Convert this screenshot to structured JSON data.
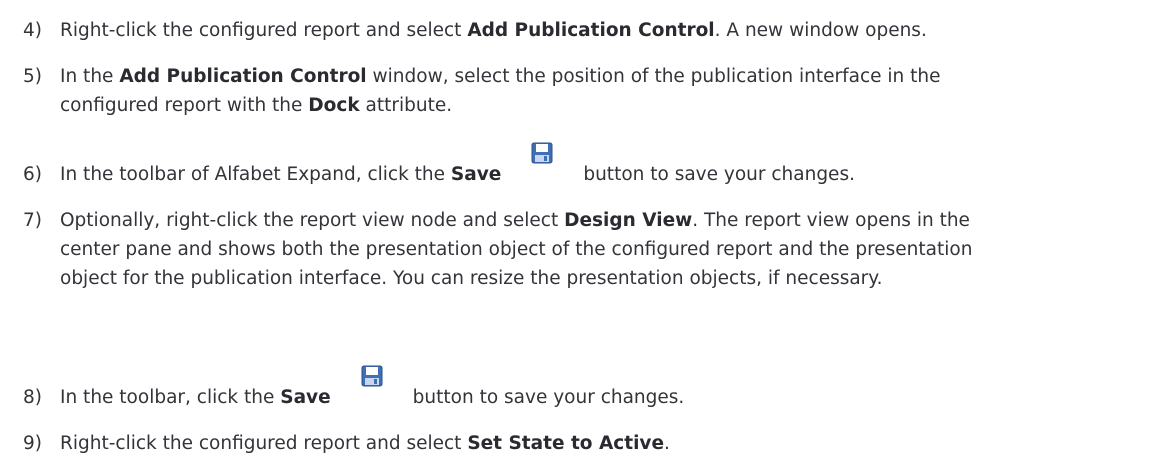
{
  "steps": [
    {
      "number": "4)",
      "segments": [
        {
          "t": "Right-click the configured report and select "
        },
        {
          "b": "Add Publication Control"
        },
        {
          "t": ". A new window opens."
        }
      ]
    },
    {
      "number": "5)",
      "line1": [
        {
          "t": "In the "
        },
        {
          "b": "Add Publication Control"
        },
        {
          "t": " window, select the position of the publication interface in the"
        }
      ],
      "line2": [
        {
          "t": "configured report with the "
        },
        {
          "b": "Dock"
        },
        {
          "t": " attribute."
        }
      ]
    },
    {
      "number": "6)",
      "before": "In the toolbar of Alfabet Expand, click the ",
      "bold": "Save",
      "after": "button to save your changes."
    },
    {
      "number": "7)",
      "line1_before": "Optionally, right-click the report view node and select ",
      "line1_bold": "Design View",
      "line1_after": ". The report view opens in the",
      "line2": "center pane and shows both the presentation object of the configured report and the presentation",
      "line3": "object for the publication interface. You can resize the presentation objects, if necessary."
    },
    {
      "number": "8)",
      "before": "In the toolbar, click the ",
      "bold": "Save",
      "after": "button to save your changes."
    },
    {
      "number": "9)",
      "before": "Right-click the configured report and select ",
      "bold": "Set State to Active",
      "after": "."
    }
  ],
  "icons": {
    "save": "save-icon"
  },
  "colors": {
    "text": "#33333a",
    "save_icon_blue": "#3f6fb5"
  }
}
